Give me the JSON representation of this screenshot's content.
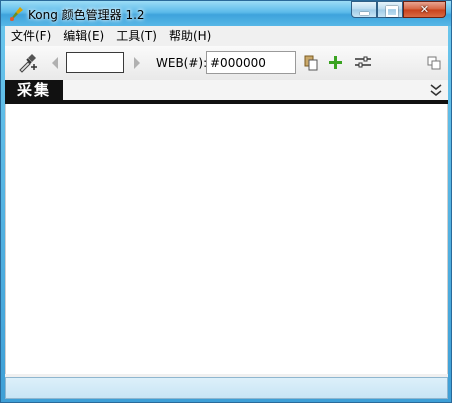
{
  "window": {
    "title": "Kong 颜色管理器 1.2"
  },
  "menu": {
    "items": [
      "文件(F)",
      "编辑(E)",
      "工具(T)",
      "帮助(H)"
    ]
  },
  "toolbar": {
    "web_label": "WEB(#):",
    "hex_value": "#000000"
  },
  "tabs": [
    {
      "label": "采集",
      "active": true
    }
  ],
  "colors": {
    "swatch": "#ffffff",
    "accent": "#3ea3dc",
    "tab_bg": "#111111"
  }
}
